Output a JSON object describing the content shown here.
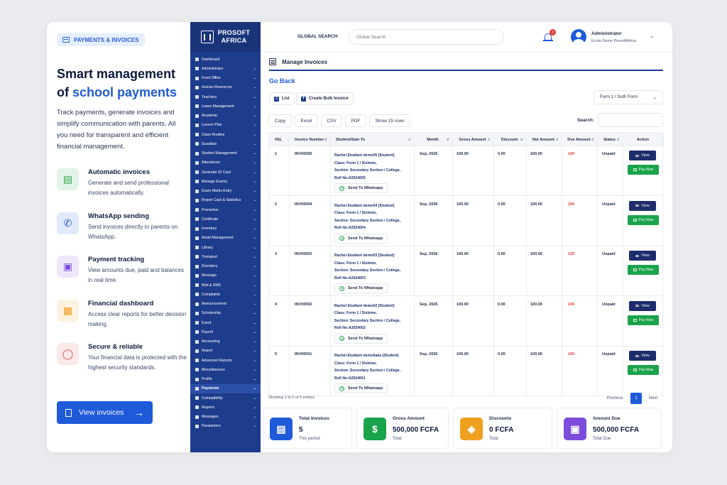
{
  "marketing": {
    "pill": "PAYMENTS & INVOICES",
    "headline_1": "Smart management",
    "headline_2a": "of ",
    "headline_2b": "school payments",
    "lead": "Track payments, generate invoices and simplify communication with parents. All you need for transparent and efficient financial management.",
    "features": [
      {
        "title": "Automatic invoices",
        "desc": "Generate and send professional invoices automatically.",
        "icon": "invoice-icon",
        "color": "#2fa84f"
      },
      {
        "title": "WhatsApp sending",
        "desc": "Send invoices directly to parents on WhatsApp.",
        "icon": "whatsapp-icon",
        "color": "#1f5ad9"
      },
      {
        "title": "Payment tracking",
        "desc": "View amounts due, paid and balances in real time.",
        "icon": "wallet-icon",
        "color": "#7c4ddb"
      },
      {
        "title": "Financial dashboard",
        "desc": "Access clear reports for better decision making.",
        "icon": "bar-chart-icon",
        "color": "#f0a020"
      },
      {
        "title": "Secure & reliable",
        "desc": "Your financial data is protected with the highest security standards.",
        "icon": "shield-icon",
        "color": "#e05050"
      }
    ],
    "cta": "View invoices"
  },
  "sidebar": {
    "brand_1": "PROSOFT",
    "brand_2": "AFRICA",
    "items": [
      "Dashboard",
      "Administrator",
      "Front Office",
      "Human Resources",
      "Teachers",
      "Leave Management",
      "Academic",
      "Lesson Plan",
      "Class Routine",
      "Guardian",
      "Student Management",
      "Attendance",
      "Generate ID Card",
      "Manage Exams",
      "Exam Marks Entry",
      "Report Card & Statistics",
      "Promotion",
      "Certificate",
      "Inventory",
      "Asset Management",
      "Library",
      "Transport",
      "Dormitory",
      "Message",
      "Mail & SMS",
      "Complaints",
      "Announcement",
      "Scholarship",
      "Event",
      "Payroll",
      "Accounting",
      "Report",
      "Advanced Reports",
      "Miscellaneous",
      "Profile",
      "Payments",
      "Compatibility",
      "Reports",
      "Messages",
      "Parameters"
    ],
    "active": "Payments"
  },
  "topbar": {
    "search_label": "GLOBAL SEARCH",
    "search_placeholder": "Global Search",
    "notif_count": "3",
    "user_name": "Administrator",
    "user_school": "Ecole Demo ProsoftAfrica"
  },
  "page": {
    "title": "Manage Invoices",
    "go_back": "Go Back",
    "list_btn": "List",
    "bulk_btn": "Create Bulk Invoice",
    "class_select": "Form 1 / Sixth Form",
    "export": [
      "Copy",
      "Excel",
      "CSV",
      "PDF",
      "Show 15 rows"
    ],
    "search_label": "Search:",
    "columns": [
      "#SL",
      "Invoice Number",
      "Student/Sale To",
      "Month",
      "Gross Amount",
      "Discount",
      "Net Amount",
      "Due Amount",
      "Status",
      "Action"
    ],
    "rows": [
      {
        "sl": "1",
        "inv": "INV00005",
        "student": "Rachel Etudiant demo05 [Student]",
        "class": "Class:  Form 1 / Sixième,",
        "section": "Section: Secondary Section / College,",
        "roll": "Roll No:A2024005",
        "month": "Sep, 2026",
        "gross": "100.00",
        "discount": "0.00",
        "net": "100.00",
        "due": "100",
        "status": "Unpaid"
      },
      {
        "sl": "2",
        "inv": "INV00004",
        "student": "Rachel Etudiant demo04 [Student]",
        "class": "Class:  Form 1 / Sixième,",
        "section": "Section: Secondary Section / College,",
        "roll": "Roll No:A2024004",
        "month": "Sep, 2026",
        "gross": "100.00",
        "discount": "0.00",
        "net": "100.00",
        "due": "100",
        "status": "Unpaid"
      },
      {
        "sl": "3",
        "inv": "INV00003",
        "student": "Rachel Etudiant demo03 [Student]",
        "class": "Class:  Form 1 / Sixième,",
        "section": "Section: Secondary Section / College,",
        "roll": "Roll No:A2024003",
        "month": "Sep, 2026",
        "gross": "100.00",
        "discount": "0.00",
        "net": "100.00",
        "due": "100",
        "status": "Unpaid"
      },
      {
        "sl": "4",
        "inv": "INV00002",
        "student": "Rachel Etudiant demo02 [Student]",
        "class": "Class:  Form 1 / Sixième,",
        "section": "Section: Secondary Section / College,",
        "roll": "Roll No:A2024002",
        "month": "Sep, 2026",
        "gross": "100.00",
        "discount": "0.00",
        "net": "100.00",
        "due": "100",
        "status": "Unpaid"
      },
      {
        "sl": "5",
        "inv": "INV00001",
        "student": "Rachel Etudiant demoltaka [Student]",
        "class": "Class:  Form 1 / Sixième,",
        "section": "Section: Secondary Section / College,",
        "roll": "Roll No:A2024001",
        "month": "Sep, 2026",
        "gross": "100.00",
        "discount": "0.00",
        "net": "100.00",
        "due": "100",
        "status": "Unpaid"
      }
    ],
    "wa_label": "Send To Whatsapp",
    "view_label": "View",
    "pay_label": "Pay Now",
    "showing": "Showing 1 to 5 of 5 entries",
    "prev": "Previous",
    "page_num": "1",
    "next": "Next"
  },
  "stats": [
    {
      "label": "Total Invoices",
      "value": "5",
      "sub": "This period",
      "color": "#1f5ad9",
      "icon": "document-icon"
    },
    {
      "label": "Gross Amount",
      "value": "500,000 FCFA",
      "sub": "Total",
      "color": "#1aa34a",
      "icon": "dollar-icon"
    },
    {
      "label": "Discounts",
      "value": "0 FCFA",
      "sub": "Total",
      "color": "#f0a020",
      "icon": "tag-icon"
    },
    {
      "label": "Amount Due",
      "value": "500,000 FCFA",
      "sub": "Total Due",
      "color": "#7c4ddb",
      "icon": "wallet-icon"
    }
  ]
}
